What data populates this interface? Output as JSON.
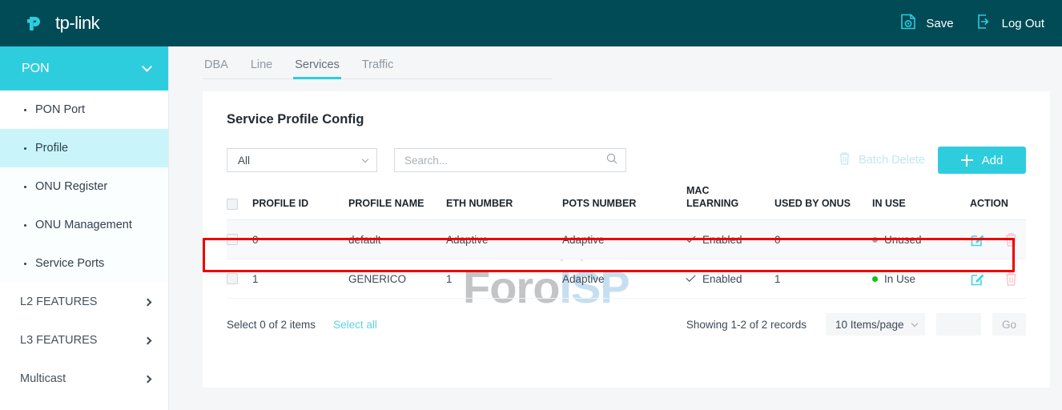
{
  "header": {
    "brand": "tp-link",
    "logo_icon": "tp-link-logo",
    "actions": [
      {
        "label": "Save",
        "icon": "save-gear-icon"
      },
      {
        "label": "Log Out",
        "icon": "logout-arrow-icon"
      }
    ]
  },
  "sidebar": {
    "group": {
      "label": "PON",
      "icon": "chevron-down-icon",
      "expanded": true
    },
    "sub_items": [
      {
        "label": "PON Port",
        "active": false
      },
      {
        "label": "Profile",
        "active": true
      },
      {
        "label": "ONU Register",
        "active": false
      },
      {
        "label": "ONU Management",
        "active": false
      },
      {
        "label": "Service Ports",
        "active": false
      }
    ],
    "items": [
      {
        "label": "L2 FEATURES",
        "icon": "chevron-right-icon"
      },
      {
        "label": "L3 FEATURES",
        "icon": "chevron-right-icon"
      },
      {
        "label": "Multicast",
        "icon": "chevron-right-icon"
      }
    ]
  },
  "tabs": [
    {
      "label": "DBA",
      "active": false
    },
    {
      "label": "Line",
      "active": false
    },
    {
      "label": "Services",
      "active": true
    },
    {
      "label": "Traffic",
      "active": false
    }
  ],
  "panel": {
    "title": "Service Profile Config"
  },
  "toolbar": {
    "filter_value": "All",
    "filter_icon": "chevron-down-icon",
    "search_placeholder": "Search...",
    "search_value": "",
    "search_icon": "search-icon",
    "batch_delete_label": "Batch Delete",
    "batch_delete_icon": "trash-icon",
    "add_label": "Add",
    "add_icon": "plus-icon"
  },
  "table": {
    "columns": [
      "PROFILE ID",
      "PROFILE NAME",
      "ETH NUMBER",
      "POTS NUMBER",
      "MAC LEARNING",
      "USED BY ONUS",
      "IN USE",
      "ACTION"
    ],
    "mac_learning_line1": "MAC",
    "mac_learning_line2": "LEARNING",
    "rows": [
      {
        "profile_id": "0",
        "profile_name": "default",
        "eth_number": "Adaptive",
        "pots_number": "Adaptive",
        "mac_learning": "Enabled",
        "used_by_onus": "0",
        "in_use": "Unused",
        "in_use_color": "#9aa3ab",
        "highlighted": false
      },
      {
        "profile_id": "1",
        "profile_name": "GENERICO",
        "eth_number": "1",
        "pots_number": "Adaptive",
        "mac_learning": "Enabled",
        "used_by_onus": "1",
        "in_use": "In Use",
        "in_use_color": "#12c40f",
        "highlighted": true
      }
    ],
    "row_action_icons": [
      "edit-icon",
      "delete-icon"
    ]
  },
  "footer": {
    "select_info": "Select 0 of 2 items",
    "select_all_label": "Select all",
    "records_info": "Showing 1-2 of 2 records",
    "items_per_page": "10 Items/page",
    "items_per_page_icon": "chevron-down-icon",
    "page_input_value": "",
    "go_label": "Go"
  },
  "watermark": {
    "part1": "Foro",
    "part2": "ISP"
  },
  "colors": {
    "header_bg": "#004b55",
    "accent": "#2ecdde",
    "active_submenu": "#c9f5fa",
    "annotation": "#ee0000",
    "in_use_green": "#12c40f",
    "unused_gray": "#9aa3ab"
  }
}
